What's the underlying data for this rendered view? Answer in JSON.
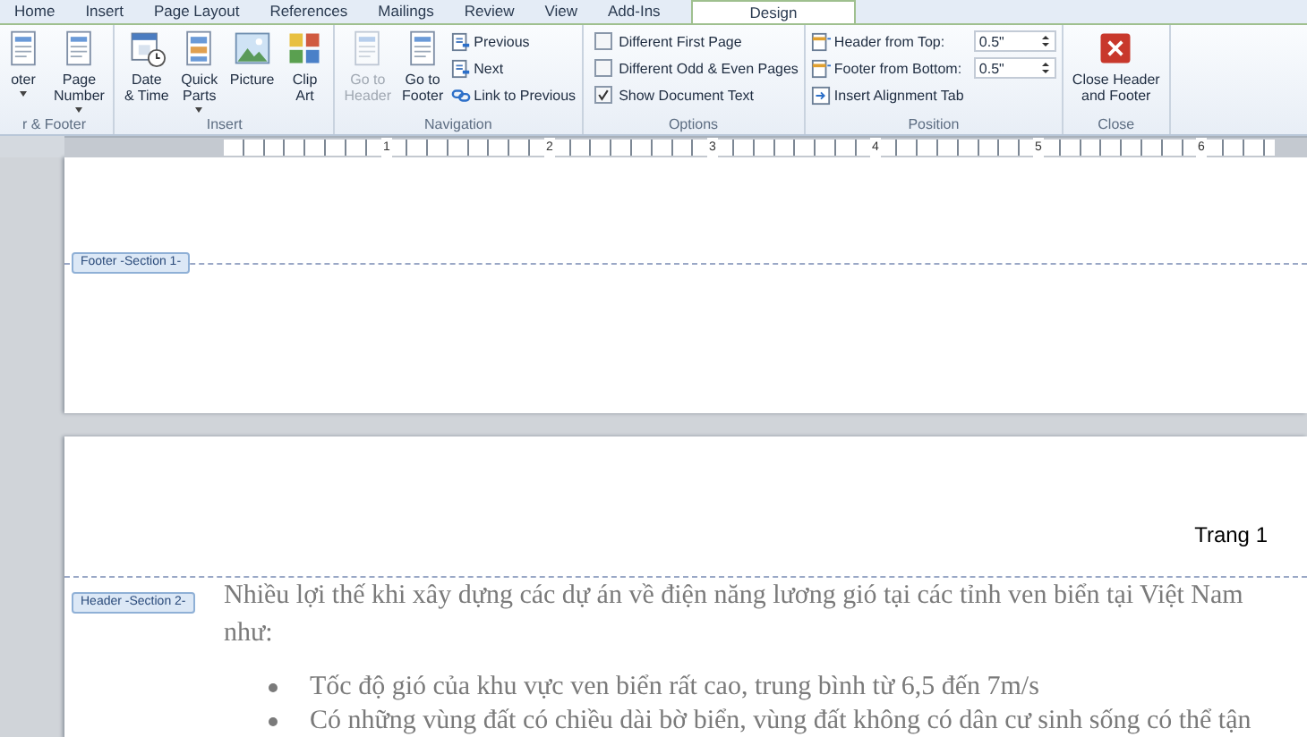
{
  "tabs": [
    {
      "label": "Home",
      "selected": false
    },
    {
      "label": "Insert",
      "selected": false
    },
    {
      "label": "Page Layout",
      "selected": false
    },
    {
      "label": "References",
      "selected": false
    },
    {
      "label": "Mailings",
      "selected": false
    },
    {
      "label": "Review",
      "selected": false
    },
    {
      "label": "View",
      "selected": false
    },
    {
      "label": "Add-Ins",
      "selected": false
    },
    {
      "label": "Design",
      "selected": true
    }
  ],
  "ribbon": {
    "groups": [
      {
        "label": "r & Footer",
        "items": [
          {
            "kind": "large",
            "lines": [
              "oter"
            ],
            "dropdown": true,
            "disabled": false
          },
          {
            "kind": "large",
            "lines": [
              "Page",
              "Number"
            ],
            "dropdown": true,
            "disabled": false
          }
        ]
      },
      {
        "label": "Insert",
        "items": [
          {
            "kind": "large",
            "lines": [
              "Date",
              "& Time"
            ],
            "dropdown": false,
            "disabled": false
          },
          {
            "kind": "large",
            "lines": [
              "Quick",
              "Parts"
            ],
            "dropdown": true,
            "disabled": false
          },
          {
            "kind": "large",
            "lines": [
              "Picture"
            ],
            "dropdown": false,
            "disabled": false
          },
          {
            "kind": "large",
            "lines": [
              "Clip",
              "Art"
            ],
            "dropdown": false,
            "disabled": false
          }
        ]
      },
      {
        "label": "Navigation",
        "items": [
          {
            "kind": "large",
            "lines": [
              "Go to",
              "Header"
            ],
            "dropdown": false,
            "disabled": true
          },
          {
            "kind": "large",
            "lines": [
              "Go to",
              "Footer"
            ],
            "dropdown": false,
            "disabled": false
          },
          {
            "kind": "stack",
            "rows": [
              {
                "kind": "small",
                "label": "Previous"
              },
              {
                "kind": "small",
                "label": "Next"
              },
              {
                "kind": "small",
                "label": "Link to Previous"
              }
            ]
          }
        ]
      },
      {
        "label": "Options",
        "items": [
          {
            "kind": "stack",
            "rows": [
              {
                "kind": "checkbox",
                "label": "Different First Page",
                "checked": false
              },
              {
                "kind": "checkbox",
                "label": "Different Odd & Even Pages",
                "checked": false
              },
              {
                "kind": "checkbox",
                "label": "Show Document Text",
                "checked": true
              }
            ]
          }
        ]
      },
      {
        "label": "Position",
        "items": [
          {
            "kind": "stack",
            "rows": [
              {
                "kind": "spinner",
                "label": "Header from Top:",
                "value": "0.5\""
              },
              {
                "kind": "spinner",
                "label": "Footer from Bottom:",
                "value": "0.5\""
              },
              {
                "kind": "small",
                "label": "Insert Alignment Tab"
              }
            ]
          }
        ]
      },
      {
        "label": "Close",
        "items": [
          {
            "kind": "large",
            "lines": [
              "Close Header",
              "and Footer"
            ],
            "dropdown": false,
            "disabled": false
          }
        ]
      }
    ]
  },
  "ruler": {
    "labels": [
      "1",
      "2",
      "3",
      "4",
      "5",
      "6"
    ]
  },
  "page_1": {
    "footer_tag": "Footer -Section 1-"
  },
  "page_2": {
    "header_text": "Trang 1",
    "header_tag": "Header -Section 2-",
    "paragraph": "Nhiều lợi thế khi xây dựng các dự án về điện năng lương gió tại các tỉnh ven biển tại Việt Nam như:",
    "bullets": [
      "Tốc độ gió của khu vực ven biển rất cao, trung bình từ 6,5 đến 7m/s",
      "Có những vùng đất có chiều dài bờ biển, vùng đất không có dân cư sinh sống có thể tận"
    ]
  }
}
